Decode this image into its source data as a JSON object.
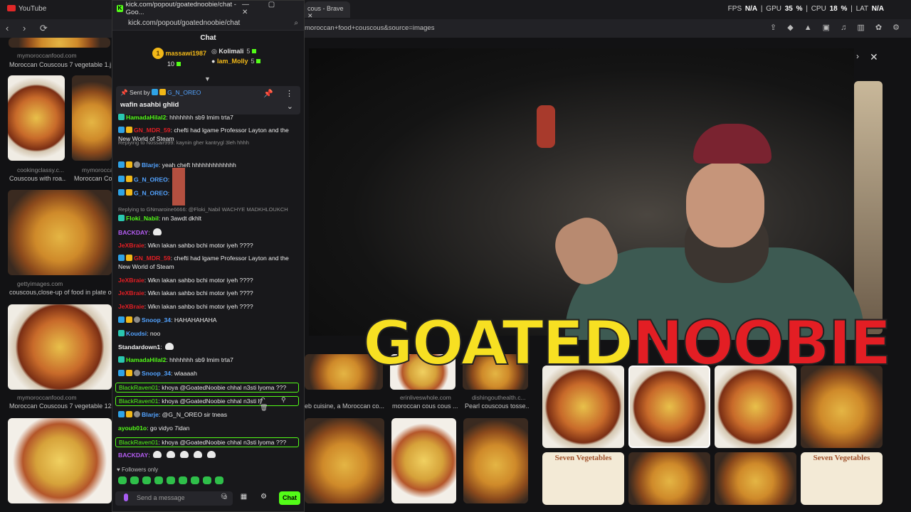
{
  "browser": {
    "bg_tab": "YouTube",
    "brave_tab": "cous - Brave",
    "stats": [
      {
        "label": "FPS",
        "value": "N/A"
      },
      {
        "label": "GPU",
        "value": "35 %"
      },
      {
        "label": "CPU",
        "value": "18 %"
      },
      {
        "label": "LAT",
        "value": "N/A"
      }
    ],
    "url": "moroccan+food+couscous&source=images"
  },
  "popout": {
    "title": "kick.com/popout/goatednoobie/chat - Goo...",
    "url": "kick.com/popout/goatednoobie/chat",
    "chat_header": "Chat",
    "leaders": [
      {
        "rank": "1",
        "name": "massawi1987",
        "count": "10"
      },
      {
        "name": "Kolimali",
        "count": "5"
      },
      {
        "name": "Iam_Molly",
        "count": "5"
      }
    ],
    "pinned": {
      "sent_by": "Sent by",
      "user": "G_N_OREO",
      "text": "wafin asahbi ghlid"
    },
    "messages": [
      {
        "user": "HamadaHilal2",
        "color": "#53fc18",
        "text": ": hhhhhhh sb9 lmim trta7",
        "badges": [
          "teal"
        ]
      },
      {
        "user": "GN_MDR_59",
        "color": "#e31e24",
        "text": ": chefti had lgame Professor Layton and the New World of Steam",
        "badges": [
          "blue",
          "gold"
        ]
      },
      {
        "reply": "Replying to Nossair999: kaynin gher kantrygl 3leh hhhh"
      },
      {
        "user": "Blarje",
        "color": "#53a3ff",
        "text": ": yeah cheft hhhhhhhhhhhhh",
        "badges": [
          "blue",
          "gold",
          "gray"
        ]
      },
      {
        "user": "G_N_OREO",
        "color": "#53a3ff",
        "text": ":",
        "badges": [
          "blue",
          "gold"
        ]
      },
      {
        "user": "G_N_OREO",
        "color": "#53a3ff",
        "text": ":",
        "badges": [
          "blue",
          "gold"
        ]
      },
      {
        "reply": "Replying to GNmaroine6666: @Floki_Nabil WACHYE MADKHLOUKCH"
      },
      {
        "user": "Floki_Nabil",
        "color": "#53fc18",
        "text": ": nn 3awdt dkhlt",
        "badges": [
          "teal"
        ]
      },
      {
        "user": "BACKDAY",
        "color": "#b45cf2",
        "text": ":",
        "badges": []
      },
      {
        "user": "JeXBraie",
        "color": "#e31e24",
        "text": ": Wkn lakan sahbo bchi motor iyeh ????",
        "badges": []
      },
      {
        "user": "GN_MDR_59",
        "color": "#e31e24",
        "text": ": chefti had lgame Professor Layton and the New World of Steam",
        "badges": [
          "blue",
          "gold"
        ]
      },
      {
        "user": "JeXBraie",
        "color": "#e31e24",
        "text": ": Wkn lakan sahbo bchi motor iyeh ????",
        "badges": []
      },
      {
        "user": "JeXBraie",
        "color": "#e31e24",
        "text": ": Wkn lakan sahbo bchi motor iyeh ????",
        "badges": []
      },
      {
        "user": "JeXBraie",
        "color": "#e31e24",
        "text": ": Wkn lakan sahbo bchi motor iyeh ????",
        "badges": []
      },
      {
        "user": "Snoop_34",
        "color": "#53a3ff",
        "text": ": HAHAHAHAHA",
        "badges": [
          "blue",
          "gold",
          "gray"
        ]
      },
      {
        "user": "Koudsi",
        "color": "#53a3ff",
        "text": ": noo",
        "badges": [
          "teal"
        ]
      },
      {
        "user": "Standardown1",
        "color": "#f0f0f0",
        "text": ":",
        "badges": []
      },
      {
        "user": "HamadaHilal2",
        "color": "#53fc18",
        "text": ": hhhhhhh sb9 lmim trta7",
        "badges": [
          "teal"
        ]
      },
      {
        "user": "Snoop_34",
        "color": "#53a3ff",
        "text": ": wlaaaah",
        "badges": [
          "blue",
          "gold",
          "gray"
        ]
      },
      {
        "user": "BlackRaven01",
        "color": "#53fc18",
        "text": ": khoya @GoatedNoobie chhal n3sti lyoma ???",
        "badges": [],
        "highlight": true
      },
      {
        "user": "BlackRaven01",
        "color": "#53fc18",
        "text": ": khoya @GoatedNoobie chhal n3sti ly",
        "badges": [],
        "highlight": true
      },
      {
        "user": "Blarje",
        "color": "#53a3ff",
        "text": ": @G_N_OREO sir tneas",
        "badges": [
          "blue",
          "gold",
          "gray"
        ]
      },
      {
        "user": "ayoub01o",
        "color": "#53fc18",
        "text": ": go vidyo 7idan",
        "badges": []
      },
      {
        "user": "BlackRaven01",
        "color": "#53fc18",
        "text": ": khoya @GoatedNoobie chhal n3sti lyoma ???",
        "badges": [],
        "highlight": true
      },
      {
        "user": "BACKDAY",
        "color": "#b45cf2",
        "text": ":",
        "badges": []
      }
    ],
    "followers_only": "Followers only",
    "input_placeholder": "Send a message",
    "chat_button": "Chat"
  },
  "images": {
    "captions": [
      {
        "src": "mymoroccanfood.com",
        "title": "Moroccan Couscous 7 vegetable 1.jpg"
      },
      {
        "src": "cookingclassy.c...",
        "title": "Couscous with roa..."
      },
      {
        "src": "mymorocca...",
        "title": "Moroccan Co..."
      },
      {
        "src": "gettyimages.com",
        "title": "couscous,close-up of food in plate on..."
      },
      {
        "src": "mymoroccanfood.com",
        "title": "Moroccan Couscous 7 vegetable 12.jpg"
      },
      {
        "src": "",
        "title": "eb cuisine, a Moroccan co..."
      },
      {
        "src": "erinliveswhole.com",
        "title": "moroccan cous cous ..."
      },
      {
        "src": "dishingouthealth.c...",
        "title": "Pearl couscous tosse..."
      }
    ],
    "seven_veg": "Seven Vegetables"
  },
  "overlay": {
    "logo_left": "GOATED",
    "logo_right": "NOOBIE"
  }
}
